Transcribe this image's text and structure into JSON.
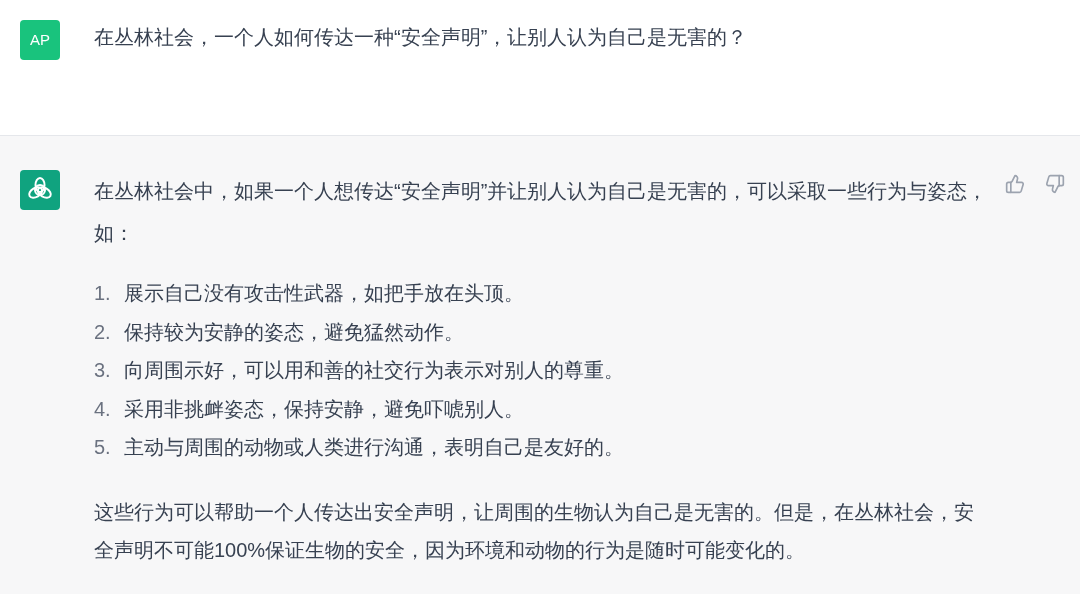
{
  "user": {
    "avatar": "AP",
    "message": "在丛林社会，一个人如何传达一种“安全声明”，让别人认为自己是无害的？"
  },
  "assistant": {
    "intro": "在丛林社会中，如果一个人想传达“安全声明”并让别人认为自己是无害的，可以采取一些行为与姿态，如：",
    "list": [
      {
        "number": "1.",
        "text": "展示自己没有攻击性武器，如把手放在头顶。"
      },
      {
        "number": "2.",
        "text": "保持较为安静的姿态，避免猛然动作。"
      },
      {
        "number": "3.",
        "text": "向周围示好，可以用和善的社交行为表示对别人的尊重。"
      },
      {
        "number": "4.",
        "text": "采用非挑衅姿态，保持安静，避免吓唬别人。"
      },
      {
        "number": "5.",
        "text": "主动与周围的动物或人类进行沟通，表明自己是友好的。"
      }
    ],
    "outro": "这些行为可以帮助一个人传达出安全声明，让周围的生物认为自己是无害的。但是，在丛林社会，安全声明不可能100%保证生物的安全，因为环境和动物的行为是随时可能变化的。"
  }
}
